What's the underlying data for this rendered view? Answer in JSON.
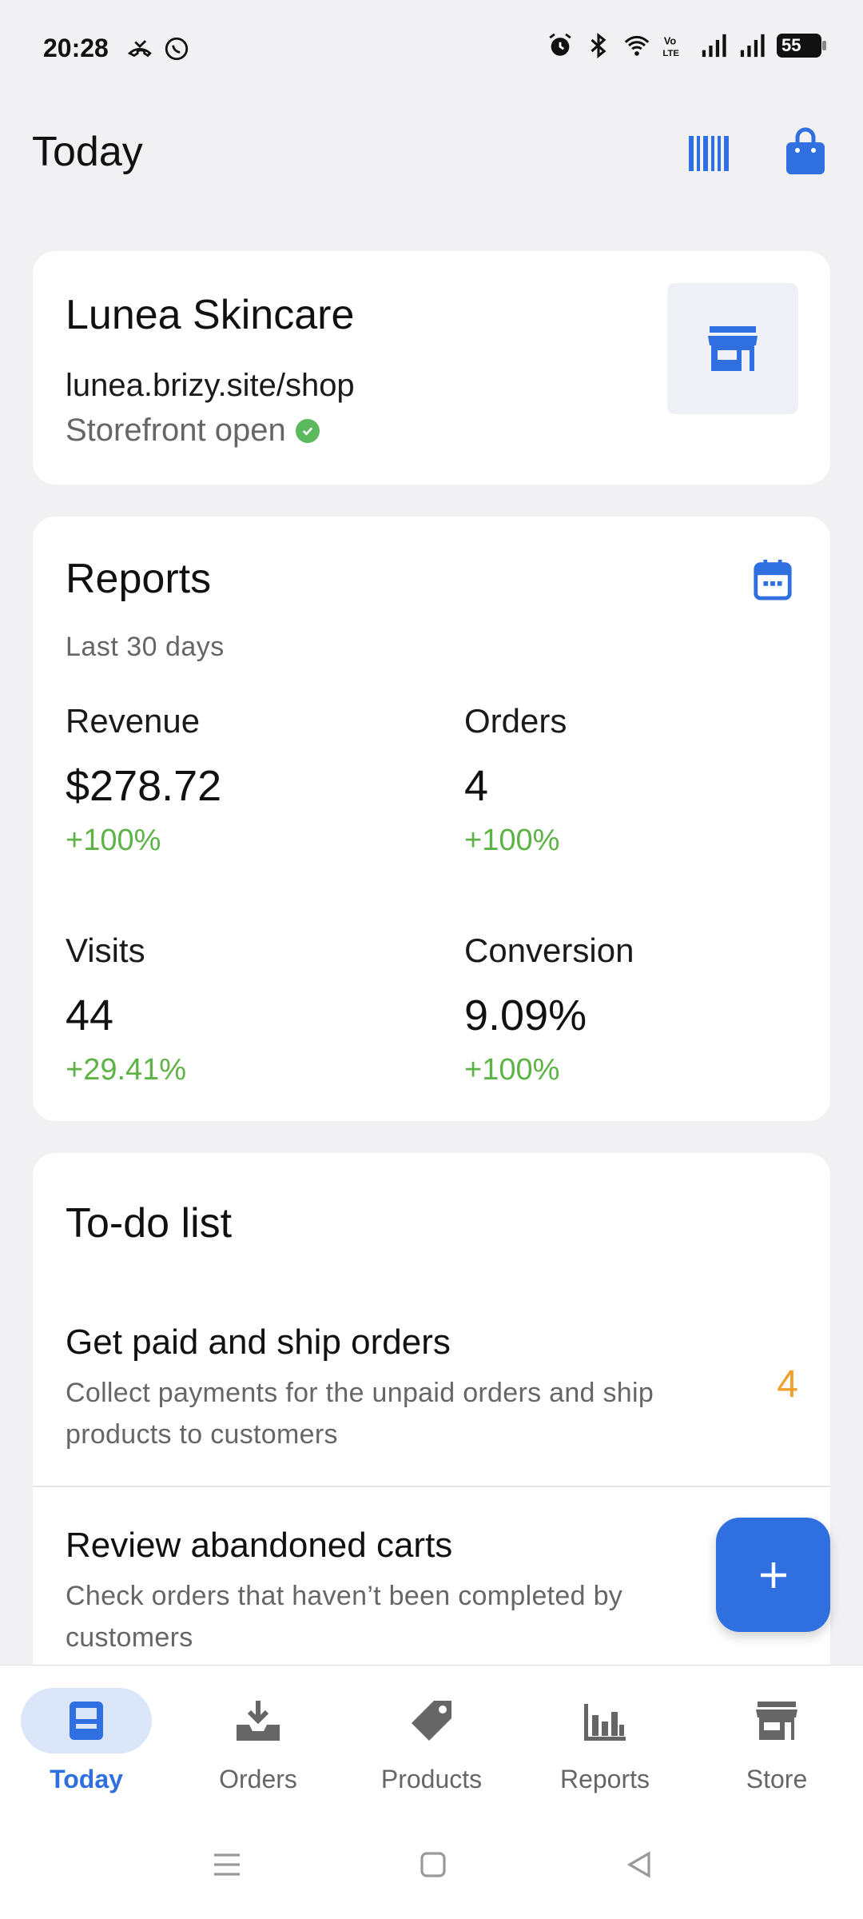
{
  "status_bar": {
    "time": "20:28",
    "battery": "55"
  },
  "header": {
    "title": "Today"
  },
  "store": {
    "name": "Lunea Skincare",
    "url": "lunea.brizy.site/shop",
    "status": "Storefront open"
  },
  "reports": {
    "title": "Reports",
    "subtitle": "Last 30 days",
    "metrics": [
      {
        "label": "Revenue",
        "value": "$278.72",
        "change": "+100%"
      },
      {
        "label": "Orders",
        "value": "4",
        "change": "+100%"
      },
      {
        "label": "Visits",
        "value": "44",
        "change": "+29.41%"
      },
      {
        "label": "Conversion",
        "value": "9.09%",
        "change": "+100%"
      }
    ]
  },
  "todo": {
    "title": "To-do list",
    "items": [
      {
        "title": "Get paid and ship orders",
        "description": "Collect payments for the unpaid orders and ship products to customers",
        "count": "4"
      },
      {
        "title": "Review abandoned carts",
        "description": "Check orders that haven’t been completed by customers",
        "count": ""
      }
    ]
  },
  "bottom_nav": {
    "items": [
      {
        "label": "Today",
        "icon": "today-icon",
        "active": true
      },
      {
        "label": "Orders",
        "icon": "orders-icon",
        "active": false
      },
      {
        "label": "Products",
        "icon": "tag-icon",
        "active": false
      },
      {
        "label": "Reports",
        "icon": "bar-chart-icon",
        "active": false
      },
      {
        "label": "Store",
        "icon": "store-icon",
        "active": false
      }
    ]
  },
  "colors": {
    "accent": "#2f6fe0",
    "positive": "#5db346",
    "warning": "#f0a030",
    "background": "#f1f1f3"
  }
}
